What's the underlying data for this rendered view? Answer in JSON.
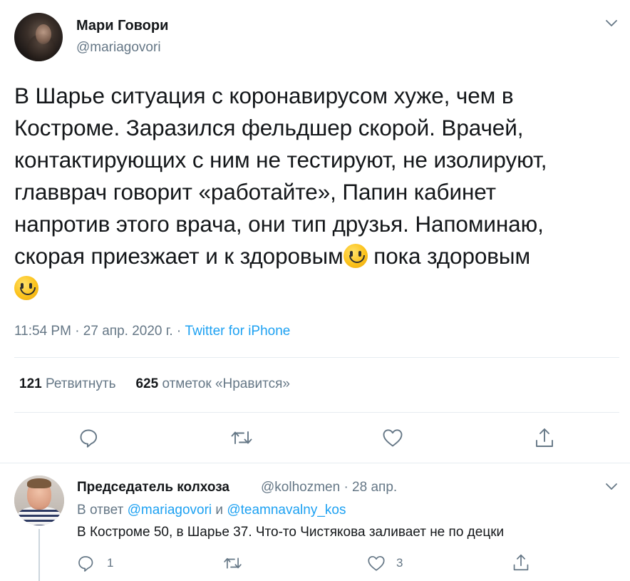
{
  "tweet": {
    "author_name": "Мари Говори",
    "author_handle": "@mariagovori",
    "text_lines": [
      "В Шарье ситуация с коронавирусом хуже, чем в",
      "Костроме. Заразился фельдшер скорой. Врачей,",
      "контактирующих с ним не тестируют, не изолируют,",
      "главврач говорит «работайте», Папин кабинет",
      "напротив этого врача, они тип друзья. Напоминаю,",
      "скорая приезжает и к здоровым",
      " пока здоровым"
    ],
    "time": "11:54 PM · 27 апр. 2020 г. · ",
    "source": "Twitter for iPhone",
    "retweets_count": "121",
    "retweets_label": "Ретвитнуть",
    "likes_count": "625",
    "likes_label": "отметок «Нравится»",
    "icons": [
      "reply-icon",
      "retweet-icon",
      "like-icon",
      "share-icon",
      "chevron-down-icon",
      "smile-emoji"
    ]
  },
  "reply": {
    "author_name": "Председатель колхоза",
    "author_handle": "@kolhozmen · 28 апр.",
    "reply_prefix": "В ответ ",
    "reply_mention_1": "@mariagovori",
    "reply_and": " и ",
    "reply_mention_2": "@teamnavalny_kos",
    "text": "В Костроме 50, в Шарье 37. Что-то Чистякова заливает не по децки",
    "reply_count": "1",
    "like_count": "3"
  },
  "colors": {
    "text": "#14171a",
    "secondary": "#657786",
    "link": "#1da1f2",
    "divider": "#e6ecf0"
  }
}
